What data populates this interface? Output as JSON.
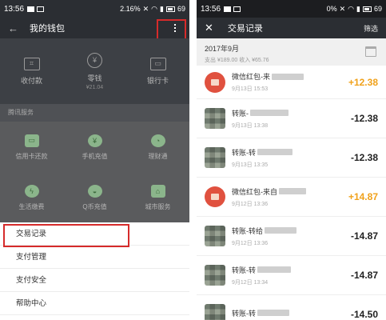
{
  "left": {
    "status": {
      "time": "13:56",
      "battery_pct": "2.16%",
      "battery": "69"
    },
    "title": "我的钱包",
    "wallet": [
      {
        "label": "收付款",
        "sub": ""
      },
      {
        "label": "零钱",
        "sub": "¥21.04"
      },
      {
        "label": "银行卡",
        "sub": ""
      }
    ],
    "section": "腾讯服务",
    "services": [
      {
        "label": "信用卡还款"
      },
      {
        "label": "手机充值"
      },
      {
        "label": "理财通"
      },
      {
        "label": "生活缴费"
      },
      {
        "label": "Q币充值"
      },
      {
        "label": "城市服务"
      }
    ],
    "menu": [
      {
        "label": "交易记录"
      },
      {
        "label": "支付管理"
      },
      {
        "label": "支付安全"
      },
      {
        "label": "帮助中心"
      }
    ]
  },
  "right": {
    "status": {
      "time": "13:56",
      "signal": "0%",
      "battery": "69"
    },
    "title": "交易记录",
    "filter": "筛选",
    "month": "2017年9月",
    "summary": "支出 ¥189.00 收入 ¥65.76",
    "transactions": [
      {
        "title": "微信红包-来",
        "date": "9月13日 15:53",
        "amount": "+12.38",
        "positive": true
      },
      {
        "title": "转账-",
        "date": "9月13日 13:38",
        "amount": "-12.38",
        "positive": false
      },
      {
        "title": "转账-转",
        "date": "9月13日 13:35",
        "amount": "-12.38",
        "positive": false
      },
      {
        "title": "微信红包-来自",
        "date": "9月12日 13:36",
        "amount": "+14.87",
        "positive": true
      },
      {
        "title": "转账-转给",
        "date": "9月12日 13:36",
        "amount": "-14.87",
        "positive": false
      },
      {
        "title": "转账-转",
        "date": "9月12日 13:34",
        "amount": "-14.87",
        "positive": false
      },
      {
        "title": "转账-转",
        "date": "",
        "amount": "-14.50",
        "positive": false
      }
    ]
  },
  "colors": {
    "highlight": "#d62b2b",
    "income": "#f0a11a",
    "header": "#2b2e33"
  }
}
